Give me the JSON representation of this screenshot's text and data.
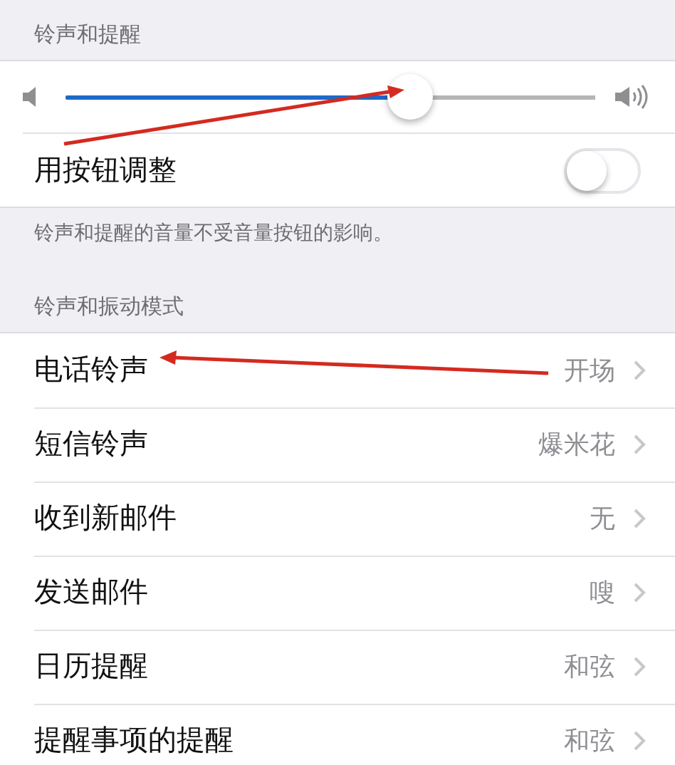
{
  "sections": [
    {
      "header": "铃声和提醒",
      "volume": {
        "level": 0.65
      },
      "toggle": {
        "label": "用按钮调整",
        "on": false
      },
      "footer": "铃声和提醒的音量不受音量按钮的影响。"
    },
    {
      "header": "铃声和振动模式",
      "rows": [
        {
          "label": "电话铃声",
          "value": "开场"
        },
        {
          "label": "短信铃声",
          "value": "爆米花"
        },
        {
          "label": "收到新邮件",
          "value": "无"
        },
        {
          "label": "发送邮件",
          "value": "嗖"
        },
        {
          "label": "日历提醒",
          "value": "和弦"
        },
        {
          "label": "提醒事项的提醒",
          "value": "和弦"
        }
      ]
    }
  ]
}
